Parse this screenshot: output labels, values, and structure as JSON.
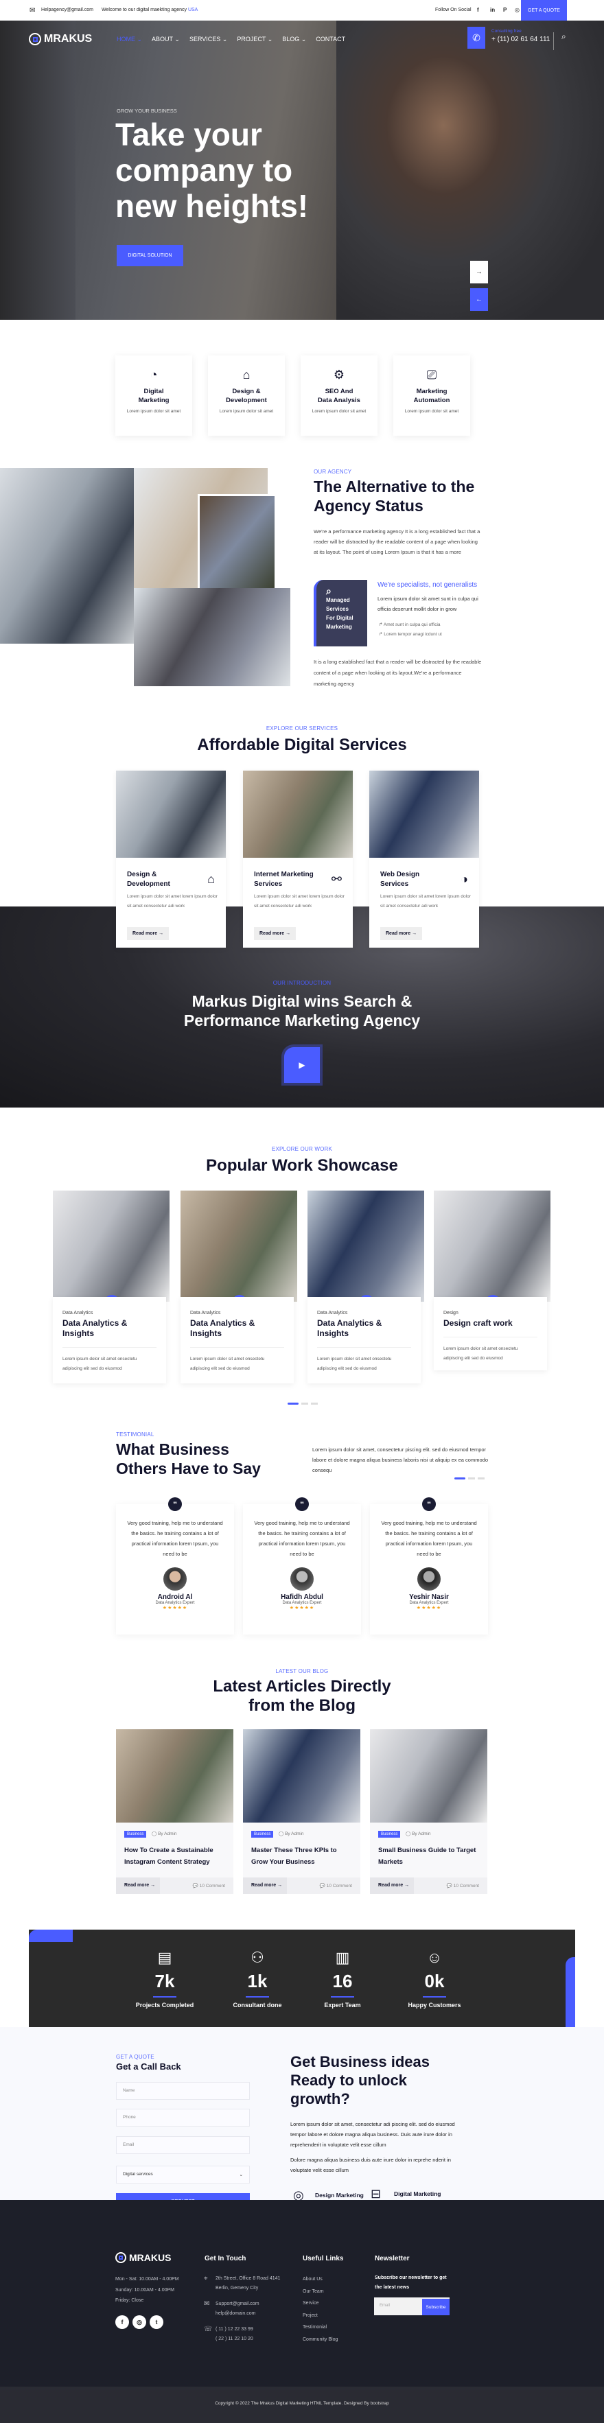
{
  "colors": {
    "accent": "#4a5cff",
    "dark_text": "#12132b",
    "stats_bg": "#2b2b2b",
    "footer_bg": "#1d1f29"
  },
  "topbar": {
    "email": "Helpagency@gmail.com",
    "welcome": "Welcome to our digital maekting agency",
    "welcome_link": "USA",
    "follow": "Follow On Social",
    "socials": [
      "facebook-icon",
      "linkedin-icon",
      "pinterest-icon",
      "instagram-icon"
    ],
    "quote_button": "GET A QUOTE"
  },
  "header": {
    "logo": "MRAKUS",
    "nav": [
      {
        "label": "HOME",
        "active": true
      },
      {
        "label": "ABOUT"
      },
      {
        "label": "SERVICES"
      },
      {
        "label": "PROJECT"
      },
      {
        "label": "BLOG"
      },
      {
        "label": "CONTACT"
      }
    ],
    "consult_label": "Consulting free",
    "phone": "+ (11) 02 61 64 111"
  },
  "hero": {
    "eyebrow": "GROW YOUR BUSINESS",
    "title_lines": [
      "Take your",
      "company to",
      "new heights!"
    ],
    "button": "DIGITAL SOLUTION",
    "next": "→",
    "prev": "←"
  },
  "features": [
    {
      "icon": "pie-chart-icon",
      "title": [
        "Digital",
        "Marketing"
      ],
      "text": "Lorem ipsum dolor sit amet"
    },
    {
      "icon": "monitor-design-icon",
      "title": [
        "Design &",
        "Development"
      ],
      "text": "Lorem ipsum dolor sit amet"
    },
    {
      "icon": "gear-chart-icon",
      "title": [
        "SEO And",
        "Data Analysis"
      ],
      "text": "Lorem ipsum dolor sit amet"
    },
    {
      "icon": "automation-icon",
      "title": [
        "Marketing",
        "Automation"
      ],
      "text": "Lorem ipsum dolor sit amet"
    }
  ],
  "about": {
    "eyebrow": "OUR AGENCY",
    "title": "The Alternative to the Agency Status",
    "text": "We're a performance marketing agency It is a long established fact that a reader will be distracted by the readable content of a page when looking at its layout. The point of using Lorem Ipsum is that it has a more",
    "box": "Managed Services For Digital Marketing",
    "sub_title": "We're specialists, not generalists",
    "sub_text": "Lorem ipsum dolor sit amet sunt in culpa qui officia deserunt mollit dolor in grow",
    "bullets": [
      "Amet sunt in culpa qui officia",
      "Lorem tempor anagi icdunt ut"
    ],
    "footer_text": "It is a long established fact that a reader will be distracted by the readable content of a page when looking at its layout.We're a performance marketing agency"
  },
  "services": {
    "eyebrow": "EXPLORE OUR SERVICES",
    "title": "Affordable Digital Services",
    "cards": [
      {
        "title": "Design & Development",
        "icon": "monitor-design-icon",
        "text": "Lorem ipsum dolor sit amet lorem ipsum dolor sit amet consectetur adi work",
        "link": "Read more"
      },
      {
        "title": "Internet Marketing Services",
        "icon": "circuit-icon",
        "text": "Lorem ipsum dolor sit amet lorem ipsum dolor sit amet consectetur adi work",
        "link": "Read more"
      },
      {
        "title": "Web Design Services",
        "icon": "chart-circle-icon",
        "text": "Lorem ipsum dolor sit amet lorem ipsum dolor sit amet consectetur adi work",
        "link": "Read more"
      }
    ]
  },
  "intro": {
    "eyebrow": "OUR INTRODUCTION",
    "title_lines": [
      "Markus Digital wins Search &",
      "Performance Marketing Agency"
    ]
  },
  "work": {
    "eyebrow": "EXPLORE OUR WORK",
    "title": "Popular Work Showcase",
    "cards": [
      {
        "category": "Data Analytics",
        "title": "Data Analytics & Insights",
        "text": "Lorem ipsum dolor sit amet onsectetu adipiscing elit sed do eiusmod"
      },
      {
        "category": "Data Analytics",
        "title": "Data Analytics & Insights",
        "text": "Lorem ipsum dolor sit amet onsectetu adipiscing elit sed do eiusmod"
      },
      {
        "category": "Data Analytics",
        "title": "Data Analytics & Insights",
        "text": "Lorem ipsum dolor sit amet onsectetu adipiscing elit sed do eiusmod"
      },
      {
        "category": "Design",
        "title": "Design craft work",
        "text": "Lorem ipsum dolor sit amet onsectetu adipiscing elit sed do eiusmod"
      }
    ]
  },
  "testimonials": {
    "eyebrow": "TESTIMONIAL",
    "title_lines": [
      "What Business",
      "Others Have to Say"
    ],
    "intro": "Lorem ipsum dolor sit amet, consectetur piscing elit. sed do eiusmod tempor labore et dolore magna aliqua business laboris nisi ut aliquip ex ea commodo consequ",
    "items": [
      {
        "quote": "Very good training, help me to understand the basics. he training contains a lot of practical information lorem Ipsum, you need to be",
        "name": "Android Al",
        "role": "Data Analytics Expert",
        "stars": "★★★★★"
      },
      {
        "quote": "Very good training, help me to understand the basics. he training contains a lot of practical information lorem Ipsum, you need to be",
        "name": "Hafidh Abdul",
        "role": "Data Analytics Expert",
        "stars": "★★★★★"
      },
      {
        "quote": "Very good training, help me to understand the basics. he training contains a lot of practical information lorem Ipsum, you need to be",
        "name": "Yeshir Nasir",
        "role": "Data Analytics Expert",
        "stars": "★★★★★"
      }
    ]
  },
  "blog": {
    "eyebrow": "LATEST OUR BLOG",
    "title_lines": [
      "Latest Articles Directly",
      "from the Blog"
    ],
    "posts": [
      {
        "tag": "Business",
        "author": "By Admin",
        "title": "How To Create a Sustainable Instagram Content Strategy",
        "link": "Read more",
        "comments": "10 Comment"
      },
      {
        "tag": "Business",
        "author": "By Admin",
        "title": "Master These Three KPIs to Grow Your Business",
        "link": "Read more",
        "comments": "10 Comment"
      },
      {
        "tag": "Business",
        "author": "By Admin",
        "title": "Small Business Guide to Target Markets",
        "link": "Read more",
        "comments": "10 Comment"
      }
    ]
  },
  "stats": [
    {
      "icon": "id-card-check-icon",
      "value": "7k",
      "label": "Projects Completed"
    },
    {
      "icon": "handshake-people-icon",
      "value": "1k",
      "label": "Consultant done"
    },
    {
      "icon": "team-cards-icon",
      "value": "16",
      "label": "Expert Team"
    },
    {
      "icon": "smiley-icon",
      "value": "0k",
      "label": "Happy Customers"
    }
  ],
  "callback": {
    "eyebrow": "GET A QUOTE",
    "title": "Get a Call Back",
    "name_placeholder": "Name",
    "phone_placeholder": "Phone",
    "email_placeholder": "Email",
    "select_value": "Digital services",
    "button": "REQUEST"
  },
  "ideas": {
    "title_lines": [
      "Get Business ideas",
      "Ready to unlock",
      "growth?"
    ],
    "text1": "Lorem ipsum dolor sit amet, consectetur adi piscing elit. sed do eiusmod tempor labore et dolore magna aliqua business. Duis aute irure dolor in reprehenderit in voluptate velit esse cillum",
    "text2": "Dolore magna aliqua business duis aute irure dolor in reprehe nderit in voluptate velit esse cillum",
    "features": [
      "Design Marketing Solution",
      "Digital Marketing Agency"
    ]
  },
  "footer": {
    "logo": "MRAKUS",
    "hours": [
      "Mon - Sat: 10.00AM - 4.00PM",
      "Sunday: 10.00AM - 4.00PM",
      "Friday: Close"
    ],
    "touch_title": "Get In Touch",
    "address": [
      "2th Street, Office 8 Road 4141",
      "Berlin, Gemeny City"
    ],
    "emails": [
      "Support@gmail.com",
      "help@domain.com"
    ],
    "phones": [
      "( 11 ) 12 22 33 99",
      "( 22 ) 11 22 10 20"
    ],
    "links_title": "Useful Links",
    "links": [
      "About Us",
      "Our Team",
      "Service",
      "Project",
      "Testimonial",
      "Community Blog"
    ],
    "news_title": "Newsletter",
    "news_text": "Subscribe our newsletter to get the latest news",
    "email_placeholder": "Email",
    "subscribe": "Subscribe",
    "copyright": "Copyright © 2022 The Mrakus Digital Marketing HTML Template. Designed By bootstrap"
  }
}
